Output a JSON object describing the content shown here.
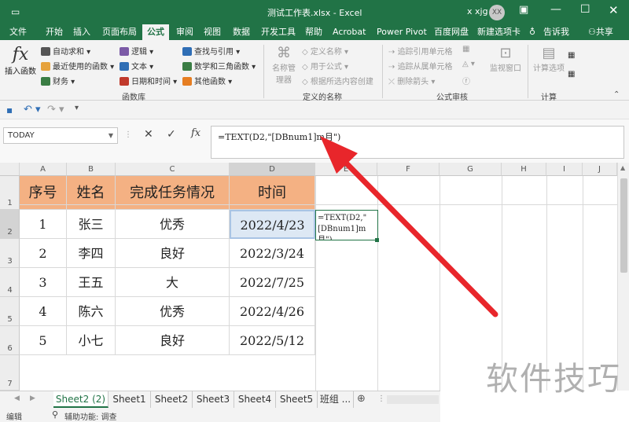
{
  "titlebar": {
    "title": "测试工作表.xlsx - Excel",
    "user": "x xjg",
    "avatar": "XX"
  },
  "menu": [
    "文件",
    "开始",
    "插入",
    "页面布局",
    "公式",
    "审阅",
    "视图",
    "数据",
    "开发工具",
    "帮助",
    "Acrobat",
    "Power Pivot",
    "百度网盘",
    "新建选项卡",
    "告诉我",
    "共享"
  ],
  "ribbon": {
    "insert_function": "插入函数",
    "lib_col1": [
      "自动求和",
      "最近使用的函数",
      "财务"
    ],
    "lib_col2": [
      "逻辑",
      "文本",
      "日期和时间"
    ],
    "lib_col3": [
      "查找与引用",
      "数学和三角函数",
      "其他函数"
    ],
    "lib_group": "函数库",
    "name_manager": "名称管理器",
    "names": [
      "定义名称",
      "用于公式",
      "根据所选内容创建"
    ],
    "names_group": "定义的名称",
    "audit_col1": [
      "追踪引用单元格",
      "追踪从属单元格",
      "删除箭头"
    ],
    "audit_group": "公式审核",
    "watch": "监视窗口",
    "calc_options": "计算选项",
    "calc_group": "计算"
  },
  "formula_bar": {
    "name_box": "TODAY",
    "fx": "fx",
    "formula": "=TEXT(D2,\"[DBnum1]m月\")"
  },
  "columns": [
    "A",
    "B",
    "C",
    "D",
    "E",
    "F",
    "G",
    "H",
    "I",
    "J"
  ],
  "rows": [
    "1",
    "2",
    "3",
    "4",
    "5",
    "6",
    "7"
  ],
  "table": {
    "headers": [
      "序号",
      "姓名",
      "完成任务情况",
      "时间"
    ],
    "rows": [
      [
        "1",
        "张三",
        "优秀",
        "2022/4/23"
      ],
      [
        "2",
        "李四",
        "良好",
        "2022/3/24"
      ],
      [
        "3",
        "王五",
        "大",
        "2022/7/25"
      ],
      [
        "4",
        "陈六",
        "优秀",
        "2022/4/26"
      ],
      [
        "5",
        "小七",
        "良好",
        "2022/5/12"
      ]
    ]
  },
  "editing_cell": "=TEXT(D2,\"[DBnum1]m月\")",
  "sheets": [
    "Sheet2 (2)",
    "Sheet1",
    "Sheet2",
    "Sheet3",
    "Sheet4",
    "Sheet5",
    "班组 ..."
  ],
  "status": {
    "mode": "编辑",
    "accessibility": "辅助功能: 调查"
  },
  "watermark": "软件技巧",
  "colors": {
    "excel_green": "#217346",
    "header_fill": "#f4b183",
    "arrow": "#e8262b"
  }
}
